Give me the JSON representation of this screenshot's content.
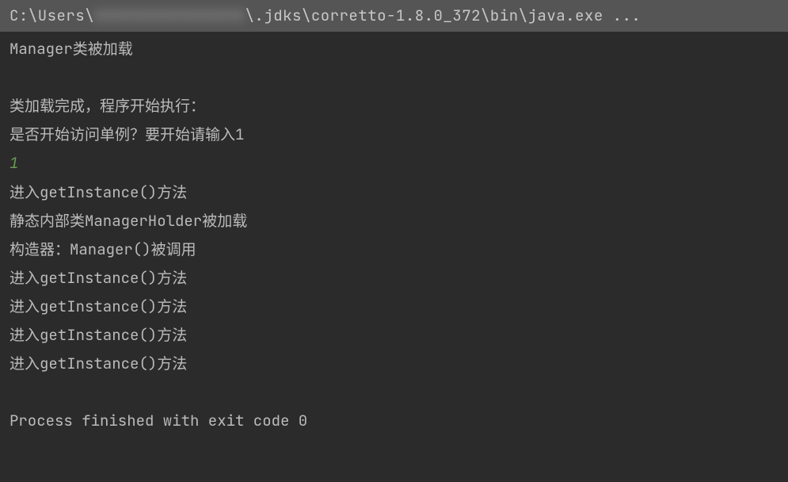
{
  "header": {
    "path_prefix": "C:\\Users\\",
    "path_censored": "XXXXXXXXXXXXXXXX",
    "path_suffix": "\\.jdks\\corretto-1.8.0_372\\bin\\java.exe ..."
  },
  "output": {
    "line1": "Manager类被加载",
    "line2": "类加载完成，程序开始执行：",
    "line3": "是否开始访问单例？要开始请输入1",
    "user_input": "1",
    "line4": "进入getInstance()方法",
    "line5": "静态内部类ManagerHolder被加载",
    "line6": "构造器：Manager()被调用",
    "line7": "进入getInstance()方法",
    "line8": "进入getInstance()方法",
    "line9": "进入getInstance()方法",
    "line10": "进入getInstance()方法",
    "exit_line": "Process finished with exit code 0"
  }
}
